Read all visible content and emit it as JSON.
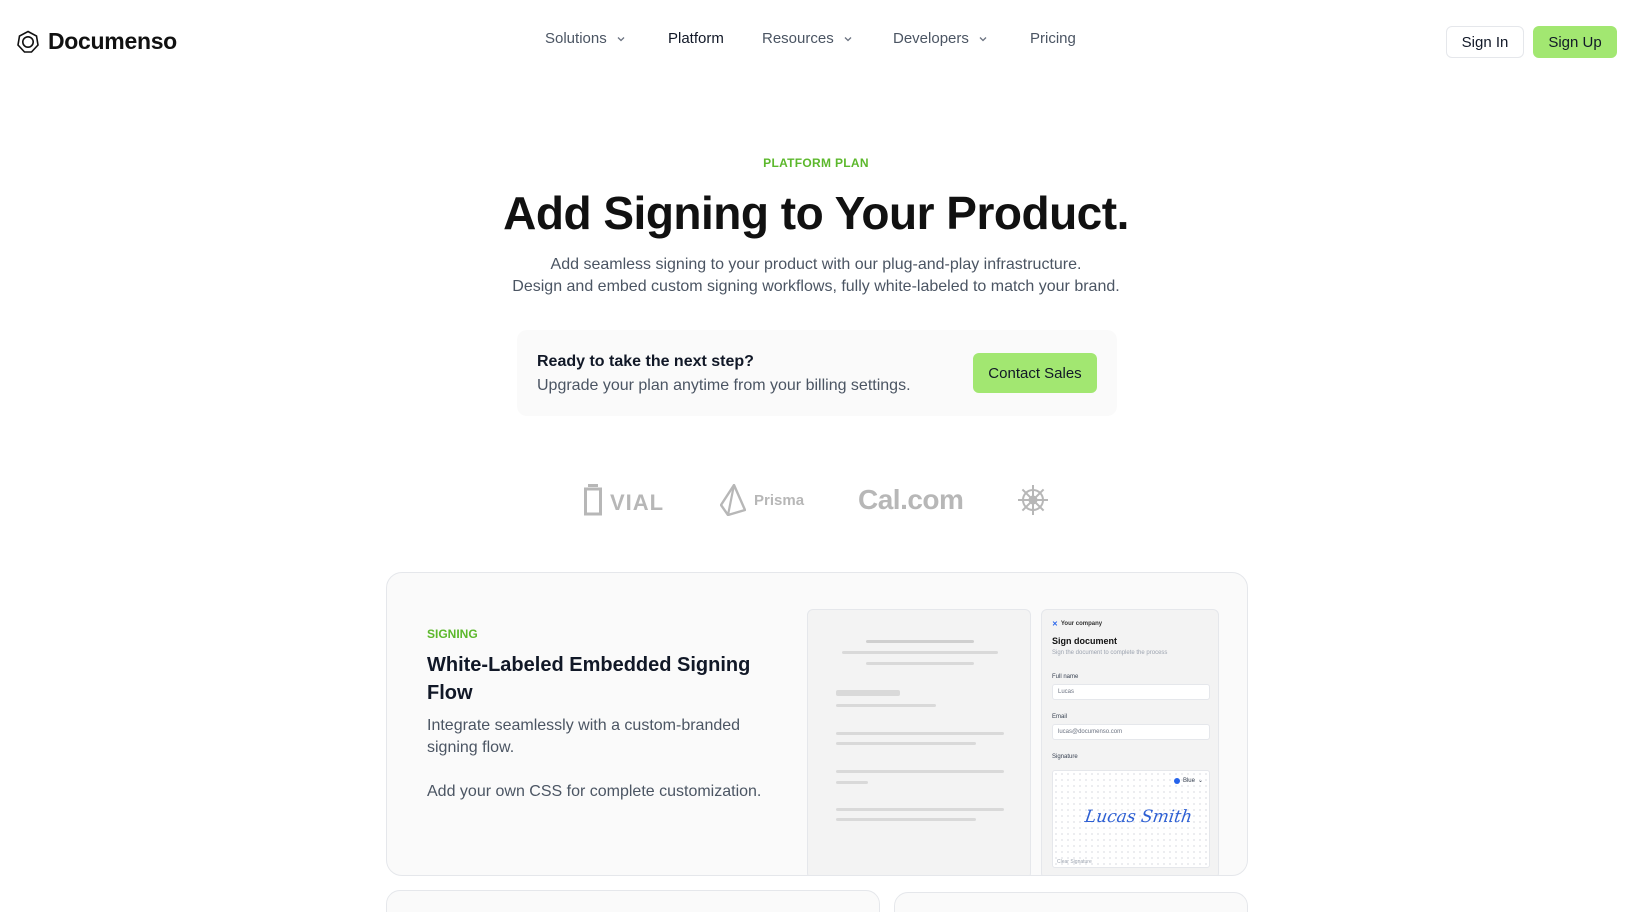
{
  "brand": {
    "name": "Documenso",
    "accent": "#a2e771",
    "eyebrow_color": "#5cb82c"
  },
  "nav": {
    "items": [
      {
        "label": "Solutions",
        "dropdown": true
      },
      {
        "label": "Platform",
        "dropdown": false,
        "active": true
      },
      {
        "label": "Resources",
        "dropdown": true
      },
      {
        "label": "Developers",
        "dropdown": true
      },
      {
        "label": "Pricing",
        "dropdown": false
      }
    ],
    "sign_in": "Sign In",
    "sign_up": "Sign Up"
  },
  "hero": {
    "eyebrow": "PLATFORM PLAN",
    "title": "Add Signing to Your Product.",
    "subtitle_line1": "Add seamless signing to your product with our plug-and-play infrastructure.",
    "subtitle_line2": "Design and embed custom signing workflows, fully white-labeled to match your brand."
  },
  "cta": {
    "title": "Ready to take the next step?",
    "subtitle": "Upgrade your plan anytime from your billing settings.",
    "button": "Contact Sales"
  },
  "customer_logos": [
    {
      "name": "VIAL",
      "icon": "vial-logo"
    },
    {
      "name": "Prisma",
      "icon": "prisma-logo"
    },
    {
      "name": "Cal.com",
      "icon": "cal-logo"
    },
    {
      "name": "",
      "icon": "ships-wheel-logo"
    }
  ],
  "feature": {
    "eyebrow": "SIGNING",
    "title": "White-Labeled Embedded Signing Flow",
    "p1": "Integrate seamlessly with a custom-branded signing flow.",
    "p2": "Add your own CSS for complete customization.",
    "mock_form": {
      "company": "Your company",
      "title": "Sign document",
      "subtitle": "Sign the document to complete the process",
      "full_name_label": "Full name",
      "full_name_value": "Lucas",
      "email_label": "Email",
      "email_value": "lucas@documenso.com",
      "signature_label": "Signature",
      "color_option": "Blue",
      "signature_text": "Lucas Smith",
      "clear_label": "Clear Signature"
    }
  }
}
